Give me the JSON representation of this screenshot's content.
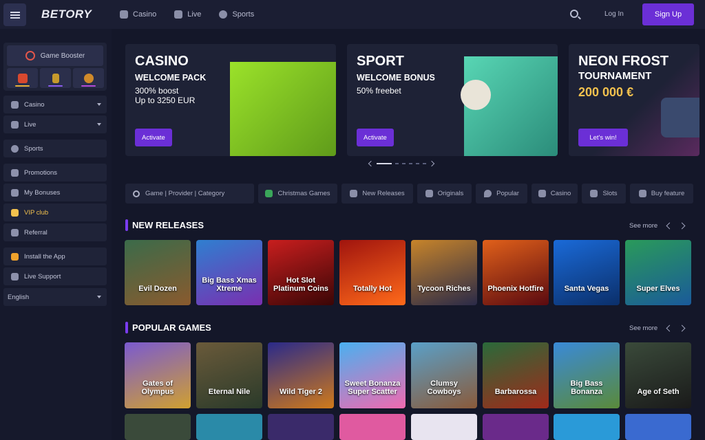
{
  "header": {
    "logo": "BETORY",
    "nav": [
      {
        "label": "Casino",
        "icon": "casino-chip-icon"
      },
      {
        "label": "Live",
        "icon": "live-icon"
      },
      {
        "label": "Sports",
        "icon": "sports-ball-icon"
      }
    ],
    "login_label": "Log In",
    "signup_label": "Sign Up"
  },
  "sidebar": {
    "booster_label": "Game Booster",
    "items": [
      {
        "label": "Casino"
      },
      {
        "label": "Live"
      },
      {
        "label": "Sports"
      },
      {
        "label": "Promotions"
      },
      {
        "label": "My Bonuses"
      },
      {
        "label": "VIP club"
      },
      {
        "label": "Referral"
      },
      {
        "label": "Install the App"
      },
      {
        "label": "Live Support"
      },
      {
        "label": "English"
      }
    ]
  },
  "banners": [
    {
      "title": "CASINO",
      "subtitle": "WELCOME PACK",
      "line1": "300% boost",
      "line2": "Up to 3250 EUR",
      "button": "Activate"
    },
    {
      "title": "SPORT",
      "subtitle": "WELCOME BONUS",
      "line1": "50% freebet",
      "button": "Activate"
    },
    {
      "title": "NEON FROST",
      "subtitle": "TOURNAMENT",
      "line1": "200 000 €",
      "button": "Let's win!"
    }
  ],
  "filters": {
    "search_placeholder": "Game | Provider | Category",
    "chips": [
      "Christmas Games",
      "New Releases",
      "Originals",
      "Popular",
      "Casino",
      "Slots",
      "Buy feature"
    ]
  },
  "sections": {
    "new_releases": {
      "title": "NEW RELEASES",
      "see_more": "See more",
      "games": [
        "Evil Dozen",
        "Big Bass Xmas Xtreme",
        "Hot Slot Platinum Coins",
        "Totally Hot",
        "Tycoon Riches",
        "Phoenix Hotfire",
        "Santa Vegas",
        "Super Elves"
      ]
    },
    "popular_games": {
      "title": "POPULAR GAMES",
      "see_more": "See more",
      "games": [
        "Gates of Olympus",
        "Eternal Nile",
        "Wild Tiger 2",
        "Sweet Bonanza Super Scatter",
        "Clumsy Cowboys",
        "Barbarossa",
        "Big Bass Bonanza",
        "Age of Seth"
      ]
    }
  },
  "colors": {
    "accent": "#6b2fd6",
    "vip": "#f2c14e",
    "bg": "#141729"
  }
}
